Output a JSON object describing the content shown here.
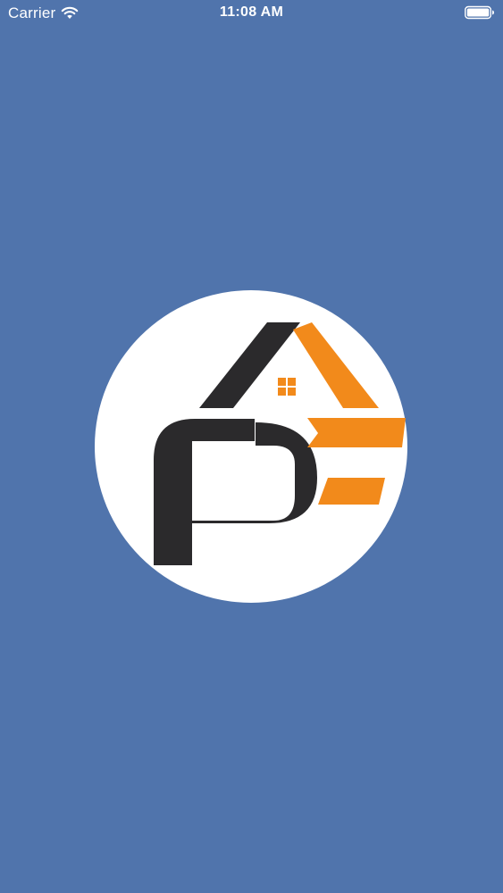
{
  "status_bar": {
    "carrier": "Carrier",
    "time": "11:08 AM",
    "wifi_icon": "wifi-icon",
    "battery_icon": "battery-icon"
  },
  "splash": {
    "logo_icon": "pe-house-logo",
    "background_color": "#5074ac",
    "logo_circle_color": "#ffffff",
    "logo_dark_color": "#2b2a2c",
    "logo_accent_color": "#f28a1b"
  }
}
